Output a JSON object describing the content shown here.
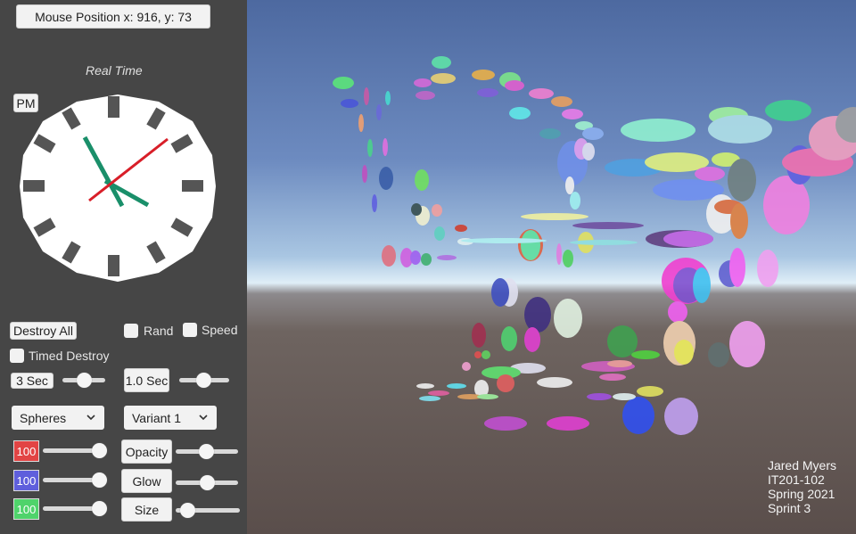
{
  "mouse_position": "Mouse Position x: 916, y: 73",
  "clock": {
    "title": "Real Time",
    "ampm_label": "PM",
    "hand_colors": {
      "hour": "#1a8f6a",
      "minute": "#1a8f6a",
      "second": "#d81e28"
    }
  },
  "controls": {
    "destroy_all_label": "Destroy All",
    "rand_label": "Rand",
    "speed_label": "Speed",
    "timed_destroy_label": "Timed Destroy",
    "timed_destroy_value": "3 Sec",
    "speed_value": "1.0 Sec",
    "shape_select": "Spheres",
    "variant_select": "Variant 1",
    "red_value": "100",
    "blue_value": "100",
    "green_value": "100",
    "opacity_label": "Opacity",
    "glow_label": "Glow",
    "size_label": "Size"
  },
  "colors": {
    "panel_bg": "#464646",
    "red": "#e24444",
    "blue": "#5f5fdc",
    "green": "#4fd36b"
  },
  "credits": {
    "name": "Jared Myers",
    "course": "IT201-102",
    "term": "Spring 2021",
    "sprint": "Sprint 3"
  }
}
